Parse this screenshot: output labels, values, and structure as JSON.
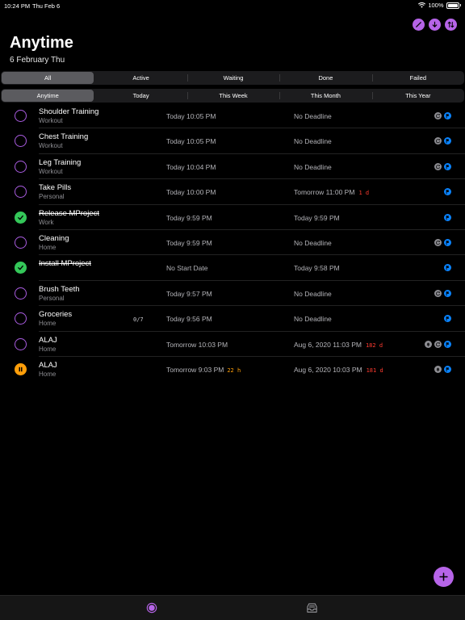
{
  "status": {
    "time": "10:24 PM",
    "date": "Thu Feb 6",
    "battery": "100%"
  },
  "header": {
    "title": "Anytime",
    "subtitle": "6 February Thu",
    "actions": [
      "edit-icon",
      "sort-down-icon",
      "sort-toggle-icon"
    ]
  },
  "filter_status": {
    "items": [
      "All",
      "Active",
      "Waiting",
      "Done",
      "Failed"
    ],
    "selected": "All"
  },
  "filter_time": {
    "items": [
      "Anytime",
      "Today",
      "This Week",
      "This Month",
      "This Year"
    ],
    "selected": "Anytime"
  },
  "tasks": [
    {
      "name": "Shoulder Training",
      "category": "Workout",
      "start": "Today 10:05 PM",
      "deadline": "No Deadline",
      "state": "open",
      "icons": [
        "repeat-icon",
        "flag-icon"
      ]
    },
    {
      "name": "Chest Training",
      "category": "Workout",
      "start": "Today 10:05 PM",
      "deadline": "No Deadline",
      "state": "open",
      "icons": [
        "repeat-icon",
        "flag-icon"
      ]
    },
    {
      "name": "Leg Training",
      "category": "Workout",
      "start": "Today 10:04 PM",
      "deadline": "No Deadline",
      "state": "open",
      "icons": [
        "repeat-icon",
        "flag-icon"
      ]
    },
    {
      "name": "Take Pills",
      "category": "Personal",
      "start": "Today 10:00 PM",
      "deadline": "Tomorrow 11:00 PM",
      "deadline_late": "1 d",
      "state": "open",
      "icons": [
        "flag-icon"
      ]
    },
    {
      "name": "Release MProject",
      "category": "Work",
      "start": "Today 9:59 PM",
      "deadline": "Today 9:59 PM",
      "state": "done",
      "icons": [
        "flag-icon"
      ]
    },
    {
      "name": "Cleaning",
      "category": "Home",
      "start": "Today 9:59 PM",
      "deadline": "No Deadline",
      "state": "open",
      "icons": [
        "repeat-icon",
        "flag-icon"
      ]
    },
    {
      "name": "Install MProject",
      "category": "",
      "start": "No Start Date",
      "deadline": "Today 9:58 PM",
      "state": "done",
      "icons": [
        "flag-icon"
      ]
    },
    {
      "name": "Brush Teeth",
      "category": "Personal",
      "start": "Today 9:57 PM",
      "deadline": "No Deadline",
      "state": "open",
      "icons": [
        "repeat-icon",
        "flag-icon"
      ]
    },
    {
      "name": "Groceries",
      "category": "Home",
      "progress": "0/7",
      "start": "Today 9:56 PM",
      "deadline": "No Deadline",
      "state": "open",
      "icons": [
        "flag-icon"
      ]
    },
    {
      "name": "ALAJ",
      "category": "Home",
      "start": "Tomorrow 10:03 PM",
      "deadline": "Aug 6, 2020 11:03 PM",
      "deadline_late": "182 d",
      "state": "open",
      "icons": [
        "bell-icon",
        "repeat-icon",
        "flag-icon"
      ]
    },
    {
      "name": "ALAJ",
      "category": "Home",
      "start": "Tomorrow 9:03 PM",
      "start_late": "22 h",
      "deadline": "Aug 6, 2020 10:03 PM",
      "deadline_late": "181 d",
      "state": "paused",
      "icons": [
        "bell-icon",
        "flag-icon"
      ]
    }
  ],
  "fab": {
    "icon": "plus-icon"
  },
  "tabbar": {
    "items": [
      "tasks-tab-icon",
      "inbox-tab-icon"
    ],
    "selected": "tasks-tab-icon"
  },
  "colors": {
    "accent": "#b664e8",
    "done": "#34c759",
    "paused": "#ff9f0a",
    "late": "#ff3b30",
    "flag": "#0a84ff"
  }
}
